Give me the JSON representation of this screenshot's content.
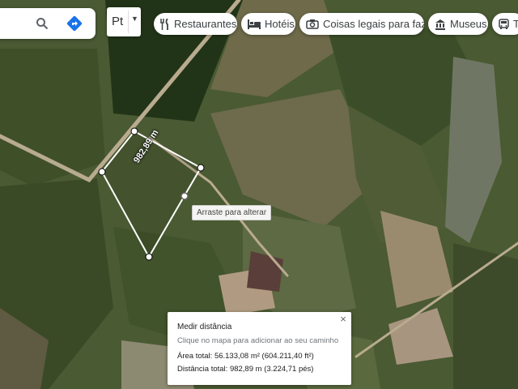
{
  "map": {
    "layer_switch_label": "Pt",
    "chips": [
      {
        "icon": "fork-knife-icon",
        "label": "Restaurantes"
      },
      {
        "icon": "bed-icon",
        "label": "Hotéis"
      },
      {
        "icon": "camera-icon",
        "label": "Coisas legais para fazer"
      },
      {
        "icon": "museum-icon",
        "label": "Museus"
      },
      {
        "icon": "bus-icon",
        "label": "Tr"
      }
    ],
    "measure_label": "982,89 m",
    "drag_tooltip": "Arraste para alterar",
    "colors": {
      "route_line": "#ffffff",
      "directions": "#1a73e8"
    }
  },
  "panel": {
    "title": "Medir distância",
    "hint": "Clique no mapa para adicionar ao seu caminho",
    "area": "Área total: 56.133,08 m² (604.211,40 ft²)",
    "distance": "Distância total: 982,89 m (3.224,71 pés)",
    "close": "×"
  }
}
